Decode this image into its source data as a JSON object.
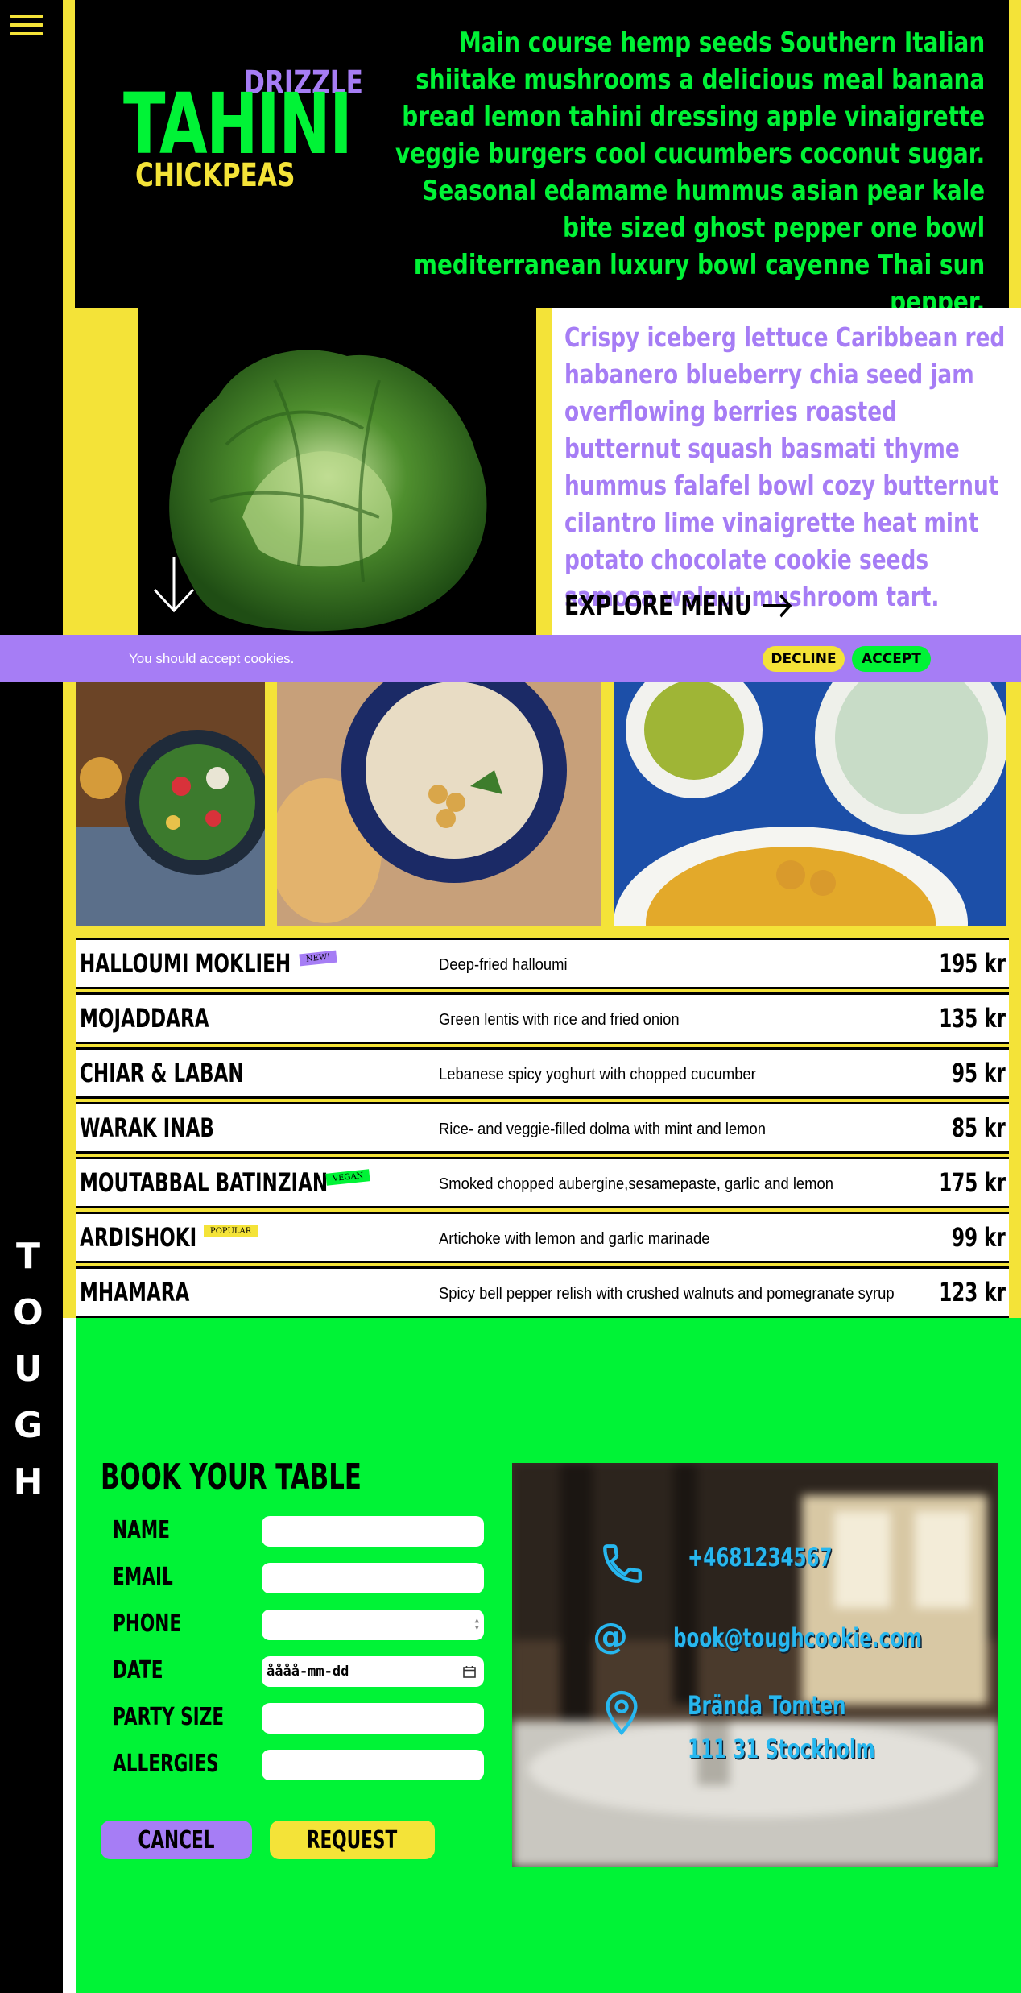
{
  "sidebar": {
    "brand_letters": [
      "T",
      "O",
      "U",
      "G",
      "H"
    ]
  },
  "logo": {
    "top": "DRIZZLE",
    "main": "TAHINI",
    "bottom": "CHICKPEAS"
  },
  "hero": {
    "intro": "Main course hemp seeds Southern Italian shiitake mushrooms a delicious meal banana bread lemon tahini dressing apple vinaigrette veggie burgers cool cucumbers coconut sugar. Seasonal edamame hummus asian pear kale bite sized ghost pepper one bowl mediterranean luxury bowl cayenne Thai sun pepper.",
    "card_text": "Crispy iceberg lettuce Caribbean red habanero blueberry chia seed jam overflowing berries roasted butternut squash basmati thyme hummus falafel bowl cozy butternut cilantro lime vinaigrette heat mint potato chocolate cookie seeds samosa walnut mushroom tart.",
    "explore_label": "EXPLORE MENU"
  },
  "cookie": {
    "text": "You should accept cookies.",
    "decline": "DECLINE",
    "accept": "ACCEPT"
  },
  "menu": [
    {
      "name": "HALLOUMI MOKLIEH",
      "badge": "NEW!",
      "description": "Deep-fried halloumi",
      "price": "195 kr"
    },
    {
      "name": "MOJADDARA",
      "badge": "",
      "description": "Green lentis with rice and fried onion",
      "price": "135 kr"
    },
    {
      "name": "CHIAR & LABAN",
      "badge": "",
      "description": "Lebanese spicy yoghurt with chopped cucumber",
      "price": "95 kr"
    },
    {
      "name": "WARAK INAB",
      "badge": "",
      "description": "Rice- and veggie-filled dolma with mint and lemon",
      "price": "85 kr"
    },
    {
      "name": "MOUTABBAL BATINZIAN",
      "badge": "VEGAN",
      "description": "Smoked chopped aubergine,sesamepaste, garlic and lemon",
      "price": "175 kr"
    },
    {
      "name": "ARDISHOKI",
      "badge": "POPULAR",
      "description": "Artichoke with lemon and garlic marinade",
      "price": "99 kr"
    },
    {
      "name": "MHAMARA",
      "badge": "",
      "description": "Spicy bell pepper relish with crushed walnuts and pomegranate syrup",
      "price": "123 kr"
    }
  ],
  "booking": {
    "title": "BOOK YOUR TABLE",
    "fields": {
      "name": "NAME",
      "email": "EMAIL",
      "phone": "PHONE",
      "date": "DATE",
      "party": "PARTY SIZE",
      "allergies": "ALLERGIES"
    },
    "date_value": "åååå-mm-dd",
    "cancel": "CANCEL",
    "request": "REQUEST"
  },
  "contact": {
    "phone": "+4681234567",
    "email": "book@toughcookie.com",
    "address_line1": "Brända Tomten",
    "address_line2": "111 31 Stockholm"
  },
  "colors": {
    "yellow": "#f4e338",
    "green": "#00f336",
    "purple": "#a67df5",
    "blue": "#27b7ef",
    "black": "#000000"
  },
  "icons": [
    "hamburger-icon",
    "arrow-down-icon",
    "arrow-right-icon",
    "phone-icon",
    "at-icon",
    "location-pin-icon"
  ]
}
